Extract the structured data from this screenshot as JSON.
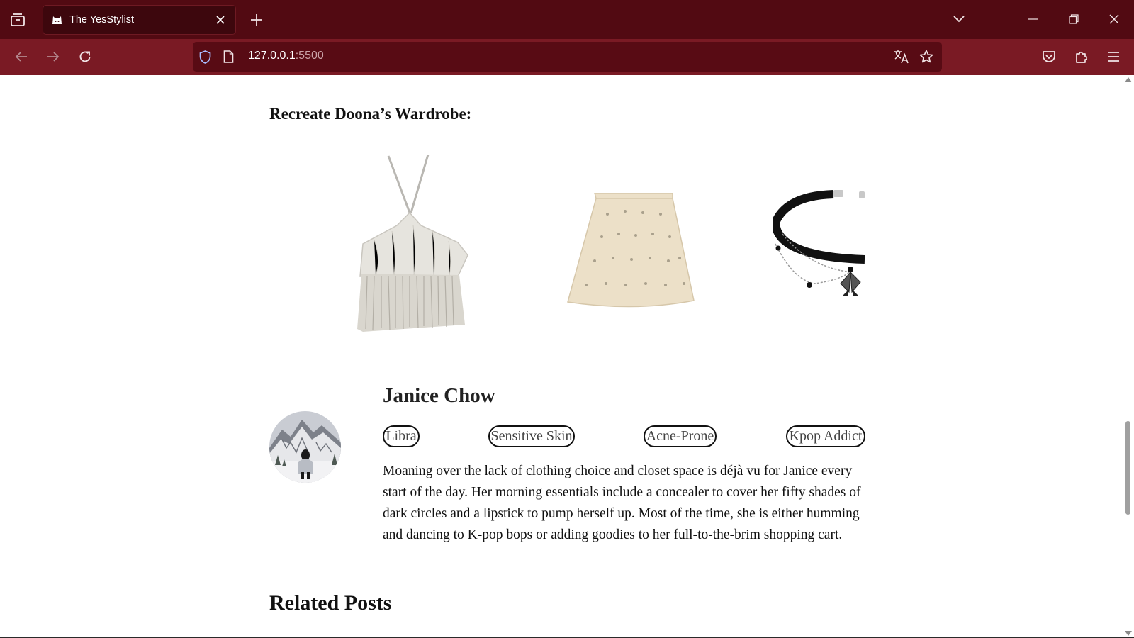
{
  "browser": {
    "tab_title": "The YesStylist",
    "url_host": "127.0.0.1",
    "url_port": ":5500",
    "icons": {
      "tab_overview": "tab-overview-icon",
      "tab_favicon": "cat-favicon-icon",
      "tab_close": "close-icon",
      "new_tab": "plus-icon",
      "tab_list": "chevron-down-icon",
      "minimize": "minimize-icon",
      "restore": "restore-icon",
      "close_window": "close-icon",
      "back": "arrow-left-icon",
      "forward": "arrow-right-icon",
      "reload": "reload-icon",
      "shield": "shield-icon",
      "page": "page-icon",
      "translate": "translate-icon",
      "bookmark": "star-icon",
      "pocket": "pocket-icon",
      "extensions": "puzzle-icon",
      "menu": "hamburger-menu-icon"
    },
    "colors": {
      "tabbar": "#520a12",
      "navbar": "#7a1a24",
      "urlbar": "#580b14"
    }
  },
  "content": {
    "wardrobe_title": "Recreate Doona’s Wardrobe:",
    "products": [
      {
        "name": "halter-fringe-top"
      },
      {
        "name": "embellished-mini-skirt"
      },
      {
        "name": "butterfly-choker-necklace"
      }
    ],
    "author": {
      "name": "Janice Chow",
      "tags": [
        "Libra",
        "Sensitive Skin",
        "Acne-Prone",
        "Kpop Addict"
      ],
      "bio": "Moaning over the lack of clothing choice and closet space is déjà vu for Janice every start of the day. Her morning essentials include a concealer to cover her fifty shades of dark circles and a lipstick to pump herself up. Most of the time, she is either humming and dancing to K-pop bops or adding goodies to her full-to-the-brim shopping cart."
    },
    "related_title": "Related Posts"
  }
}
